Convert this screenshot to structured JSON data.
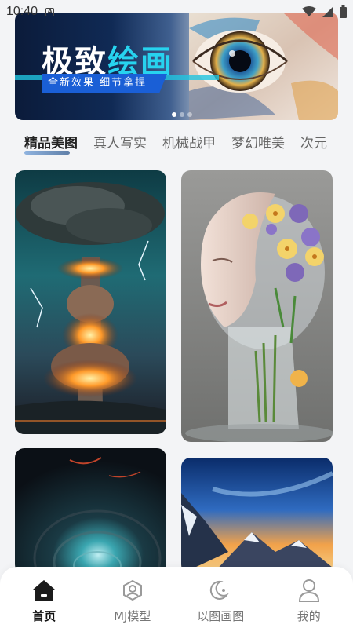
{
  "status_bar": {
    "time": "10:40"
  },
  "banner": {
    "title_part1": "极致",
    "title_part2": "绘画",
    "subtitle": "全新效果  细节拿捏",
    "dots_total": 3,
    "dots_active_index": 0
  },
  "tabs": [
    {
      "label": "精品美图",
      "active": true
    },
    {
      "label": "真人写实",
      "active": false
    },
    {
      "label": "机械战甲",
      "active": false
    },
    {
      "label": "梦幻唯美",
      "active": false
    },
    {
      "label": "次元",
      "active": false
    }
  ],
  "bottom_nav": [
    {
      "label": "首页",
      "icon": "home-icon",
      "active": true
    },
    {
      "label": "MJ模型",
      "icon": "model-icon",
      "active": false
    },
    {
      "label": "以图画图",
      "icon": "moon-icon",
      "active": false
    },
    {
      "label": "我的",
      "icon": "user-icon",
      "active": false
    }
  ],
  "colors": {
    "accent": "#27d3ef",
    "banner_label_bg": "#1a5fd6",
    "active_text": "#111111",
    "inactive_text": "#777777"
  }
}
